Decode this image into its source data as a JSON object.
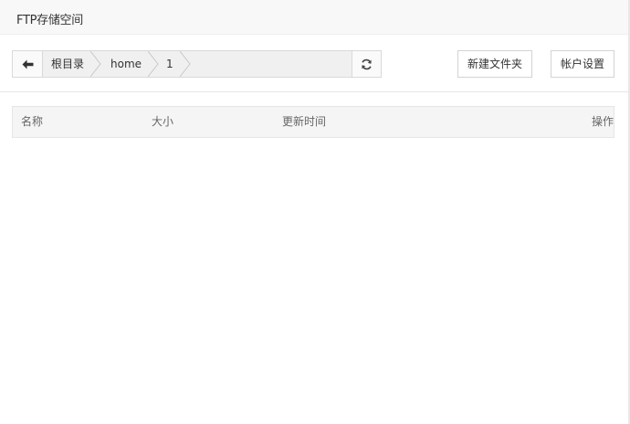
{
  "dialog": {
    "title": "FTP存储空间"
  },
  "toolbar": {
    "back_icon": "arrow-left-icon",
    "breadcrumbs": [
      "根目录",
      "home",
      "1"
    ],
    "refresh_icon": "refresh-icon",
    "new_folder_label": "新建文件夹",
    "account_settings_label": "帐户设置"
  },
  "table": {
    "columns": [
      "名称",
      "大小",
      "更新时间",
      "操作"
    ],
    "rows": []
  }
}
